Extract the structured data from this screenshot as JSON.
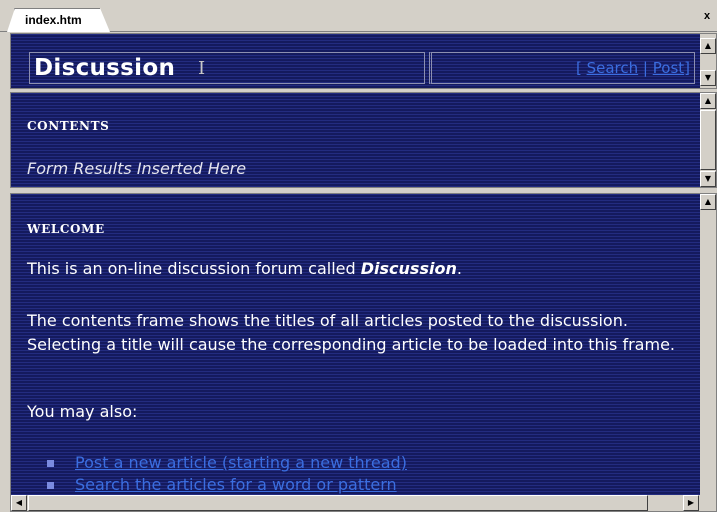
{
  "tab": {
    "label": "index.htm",
    "close": "x"
  },
  "header": {
    "title": "Discussion",
    "links_open": "[",
    "search": "Search",
    "separator": "|",
    "post": "Post",
    "links_close": "]"
  },
  "contents": {
    "heading": "CONTENTS",
    "form_results": "Form Results Inserted Here"
  },
  "welcome": {
    "heading": "WELCOME",
    "intro_before": "This is an on-line discussion forum called ",
    "intro_name": "Discussion",
    "intro_after": ".",
    "paragraph2": "The contents frame shows the titles of all articles posted to the discussion. Selecting a title will cause the corresponding article to be loaded into this frame.",
    "paragraph3": "You may also:",
    "links": [
      "Post a new article (starting a new thread)",
      "Search the articles for a word or pattern"
    ]
  }
}
